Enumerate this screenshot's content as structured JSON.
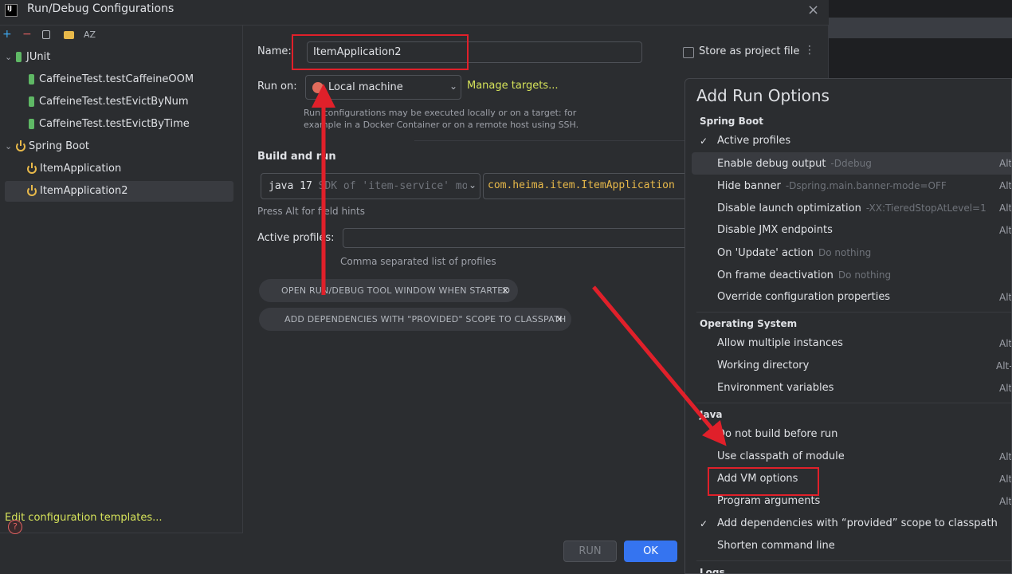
{
  "dialog": {
    "title": "Run/Debug Configurations",
    "app_logo": "IJ",
    "close_label": "×"
  },
  "toolbar": {
    "add": "+",
    "remove": "−",
    "copy_icon": "copy-icon",
    "folder_icon": "folder-add-icon",
    "sort": "AZ"
  },
  "tree": {
    "junit": {
      "label": "JUnit",
      "items": [
        "CaffeineTest.testCaffeineOOM",
        "CaffeineTest.testEvictByNum",
        "CaffeineTest.testEvictByTime"
      ]
    },
    "spring_boot": {
      "label": "Spring Boot",
      "items": [
        "ItemApplication",
        "ItemApplication2"
      ]
    },
    "edit_templates": "Edit configuration templates...",
    "help": "?"
  },
  "form": {
    "name_label": "Name:",
    "name_value": "ItemApplication2",
    "store_label": "Store as project file",
    "run_on_label": "Run on:",
    "run_on_value": "Local machine",
    "manage_targets": "Manage targets...",
    "run_on_hint_1": "Run configurations may be executed locally or on a target: for",
    "run_on_hint_2": "example in a Docker Container or on a remote host using SSH.",
    "build_run_label": "Build and run",
    "jdk_value": "java 17",
    "jdk_desc": "SDK of 'item-service' mo",
    "main_class": "com.heima.item.ItemApplication",
    "alt_hint": "Press Alt for field hints",
    "active_profiles_label": "Active profiles:",
    "active_profiles_value": "",
    "active_profiles_hint": "Comma separated list of profiles",
    "chip_1": "OPEN RUN/DEBUG TOOL WINDOW WHEN STARTED",
    "chip_2": "ADD DEPENDENCIES WITH \"PROVIDED\" SCOPE TO CLASSPATH",
    "chip_close": "×",
    "run_button": "RUN",
    "ok_button": "OK"
  },
  "popup": {
    "title": "Add Run Options",
    "sections": {
      "spring_boot": "Spring Boot",
      "os": "Operating System",
      "java": "Java",
      "logs": "Logs"
    },
    "options": [
      {
        "name": "Active profiles",
        "sub": "",
        "shortcut": "",
        "checked": "✓"
      },
      {
        "name": "Enable debug output",
        "sub": "-Ddebug",
        "shortcut": "Alt",
        "checked": ""
      },
      {
        "name": "Hide banner",
        "sub": "-Dspring.main.banner-mode=OFF",
        "shortcut": "Alt",
        "checked": ""
      },
      {
        "name": "Disable launch optimization",
        "sub": "-XX:TieredStopAtLevel=1",
        "shortcut": "Alt",
        "checked": ""
      },
      {
        "name": "Disable JMX endpoints",
        "sub": "",
        "shortcut": "Alt",
        "checked": ""
      },
      {
        "name": "On 'Update' action",
        "sub": "Do nothing",
        "shortcut": "",
        "checked": ""
      },
      {
        "name": "On frame deactivation",
        "sub": "Do nothing",
        "shortcut": "",
        "checked": ""
      },
      {
        "name": "Override configuration properties",
        "sub": "",
        "shortcut": "Alt",
        "checked": ""
      },
      {
        "name": "Allow multiple instances",
        "sub": "",
        "shortcut": "Alt-",
        "checked": ""
      },
      {
        "name": "Working directory",
        "sub": "",
        "shortcut": "Alt-",
        "checked": ""
      },
      {
        "name": "Environment variables",
        "sub": "",
        "shortcut": "Alt",
        "checked": ""
      },
      {
        "name": "Do not build before run",
        "sub": "",
        "shortcut": "",
        "checked": ""
      },
      {
        "name": "Use classpath of module",
        "sub": "",
        "shortcut": "Alt",
        "checked": ""
      },
      {
        "name": "Add VM options",
        "sub": "",
        "shortcut": "Alt",
        "checked": ""
      },
      {
        "name": "Program arguments",
        "sub": "",
        "shortcut": "Alt",
        "checked": ""
      },
      {
        "name": "Add dependencies with “provided” scope to classpath",
        "sub": "",
        "shortcut": "",
        "checked": "✓"
      },
      {
        "name": "Shorten command line",
        "sub": "",
        "shortcut": "",
        "checked": ""
      }
    ]
  },
  "colors": {
    "accent": "#3574f0",
    "link": "#d6e35a",
    "annotation": "#e0202a"
  }
}
